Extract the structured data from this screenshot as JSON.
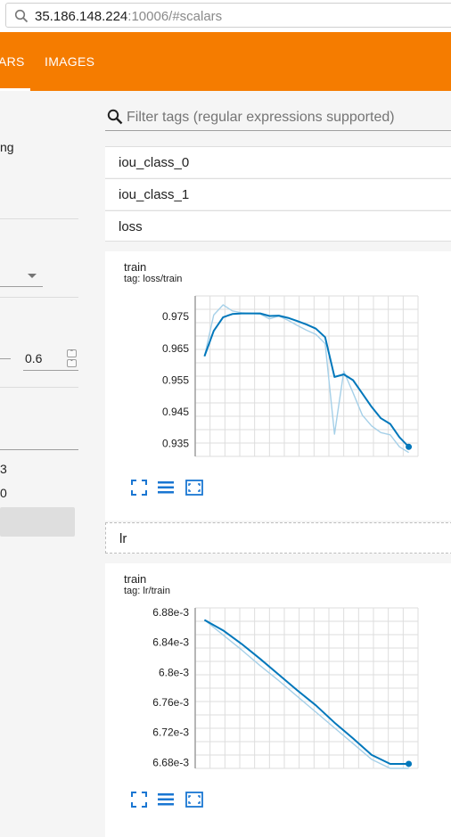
{
  "browser": {
    "url_host": "35.186.148.224",
    "url_rest": ":10006/#scalars"
  },
  "toolbar": {
    "tabs": [
      {
        "label": "ARS",
        "active": true
      },
      {
        "label": "IMAGES",
        "active": false
      }
    ]
  },
  "sidebar": {
    "partial_label": "ng",
    "smoothing_value": "0.6",
    "partial_digit_1": "3",
    "partial_digit_2": "0"
  },
  "filter": {
    "placeholder": "Filter tags (regular expressions supported)"
  },
  "categories": [
    {
      "name": "iou_class_0"
    },
    {
      "name": "iou_class_1"
    },
    {
      "name": "loss"
    },
    {
      "name": "lr"
    }
  ],
  "colors": {
    "accent": "#f57c00",
    "series": "#0077bb",
    "series_raw": "#a6d0e8",
    "icon": "#1976d2"
  },
  "chart_data": [
    {
      "type": "line",
      "title": "train",
      "subtitle": "tag: loss/train",
      "ylim": [
        0.931,
        0.9815
      ],
      "yticks": [
        0.935,
        0.945,
        0.955,
        0.965,
        0.975
      ],
      "ytick_labels": [
        "0.935",
        "0.945",
        "0.955",
        "0.965",
        "0.975"
      ],
      "series": [
        {
          "role": "smoothed",
          "x": [
            0,
            1,
            2,
            3,
            4,
            5,
            6,
            7,
            8,
            9,
            10,
            11,
            12,
            13,
            14,
            15,
            16,
            17,
            18,
            19,
            20,
            21,
            22
          ],
          "values": [
            0.9625,
            0.9705,
            0.9748,
            0.9758,
            0.976,
            0.976,
            0.976,
            0.9752,
            0.9753,
            0.9746,
            0.9736,
            0.9725,
            0.9712,
            0.9685,
            0.956,
            0.9568,
            0.955,
            0.9508,
            0.9466,
            0.943,
            0.9412,
            0.937,
            0.934
          ]
        },
        {
          "role": "raw",
          "x": [
            0,
            1,
            2,
            3,
            4,
            5,
            6,
            7,
            8,
            9,
            10,
            11,
            12,
            13,
            14,
            15,
            16,
            17,
            18,
            19,
            20,
            21,
            22
          ],
          "values": [
            0.9625,
            0.9755,
            0.9787,
            0.9768,
            0.9762,
            0.976,
            0.9758,
            0.9743,
            0.9752,
            0.9738,
            0.9722,
            0.9707,
            0.9694,
            0.9665,
            0.938,
            0.9578,
            0.951,
            0.944,
            0.9406,
            0.9385,
            0.9378,
            0.934,
            0.9322
          ]
        }
      ]
    },
    {
      "type": "line",
      "title": "train",
      "subtitle": "tag: lr/train",
      "ylim": [
        6.672,
        6.886
      ],
      "yticks": [
        6.68,
        6.72,
        6.76,
        6.8,
        6.84,
        6.88
      ],
      "ytick_labels": [
        "6.68e-3",
        "6.72e-3",
        "6.76e-3",
        "6.8e-3",
        "6.84e-3",
        "6.88e-3"
      ],
      "series": [
        {
          "role": "smoothed",
          "x": [
            0,
            2,
            4,
            6,
            8,
            10,
            12,
            14,
            16,
            18,
            20,
            22
          ],
          "values": [
            6.87,
            6.856,
            6.838,
            6.818,
            6.797,
            6.776,
            6.756,
            6.733,
            6.712,
            6.69,
            6.678,
            6.678
          ]
        },
        {
          "role": "raw",
          "x": [
            0,
            2,
            4,
            6,
            8,
            10,
            12,
            14,
            16,
            18,
            20,
            22
          ],
          "values": [
            6.87,
            6.85,
            6.83,
            6.809,
            6.789,
            6.768,
            6.747,
            6.726,
            6.705,
            6.684,
            6.672,
            6.672
          ]
        }
      ]
    }
  ]
}
